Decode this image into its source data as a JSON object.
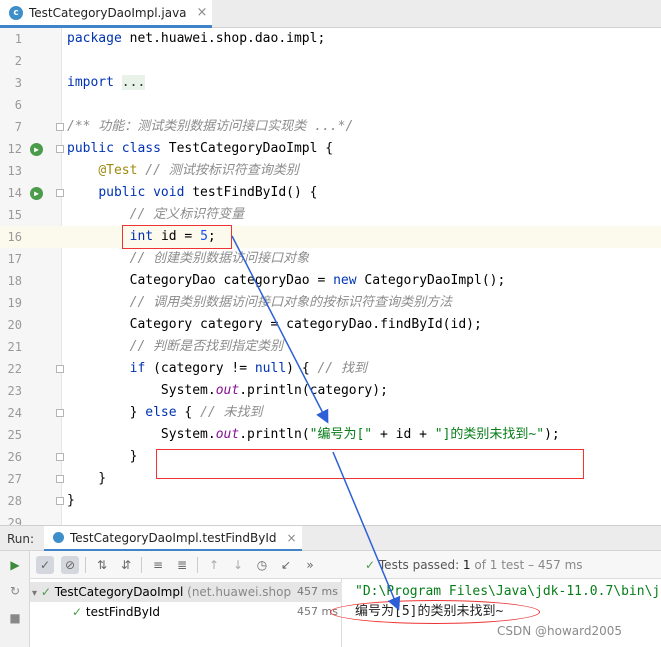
{
  "editor_tab": {
    "icon": "class-icon",
    "label": "TestCategoryDaoImpl.java",
    "close": "×"
  },
  "code_lines": [
    {
      "num": "1",
      "parts": [
        [
          "kw",
          "package "
        ],
        [
          "",
          "net.huawei.shop.dao.impl;"
        ]
      ]
    },
    {
      "num": "2",
      "parts": []
    },
    {
      "num": "3",
      "parts": [
        [
          "kw",
          "import "
        ],
        [
          "fold",
          "..."
        ]
      ]
    },
    {
      "num": "6",
      "parts": []
    },
    {
      "num": "7",
      "parts": [
        [
          "cm",
          "/** 功能：测试类别数据访问接口实现类 ...*/"
        ]
      ]
    },
    {
      "num": "12",
      "parts": [
        [
          "kw",
          "public class "
        ],
        [
          "",
          "TestCategoryDaoImpl {"
        ]
      ]
    },
    {
      "num": "13",
      "parts": [
        [
          "",
          "    "
        ],
        [
          "an",
          "@Test"
        ],
        [
          "cm",
          " // 测试按标识符查询类别"
        ]
      ]
    },
    {
      "num": "14",
      "parts": [
        [
          "",
          "    "
        ],
        [
          "kw",
          "public void "
        ],
        [
          "",
          "testFindById() {"
        ]
      ]
    },
    {
      "num": "15",
      "parts": [
        [
          "cm",
          "        // 定义标识符变量"
        ]
      ]
    },
    {
      "num": "16",
      "parts": [
        [
          "",
          "        "
        ],
        [
          "kw",
          "int "
        ],
        [
          "",
          "id = "
        ],
        [
          "nu",
          "5"
        ],
        [
          "",
          ";"
        ]
      ]
    },
    {
      "num": "17",
      "parts": [
        [
          "cm",
          "        // 创建类别数据访问接口对象"
        ]
      ]
    },
    {
      "num": "18",
      "parts": [
        [
          "",
          "        CategoryDao categoryDao = "
        ],
        [
          "kw",
          "new "
        ],
        [
          "",
          "CategoryDaoImpl();"
        ]
      ]
    },
    {
      "num": "19",
      "parts": [
        [
          "cm",
          "        // 调用类别数据访问接口对象的按标识符查询类别方法"
        ]
      ]
    },
    {
      "num": "20",
      "parts": [
        [
          "",
          "        Category category = categoryDao.findById(id);"
        ]
      ]
    },
    {
      "num": "21",
      "parts": [
        [
          "cm",
          "        // 判断是否找到指定类别"
        ]
      ]
    },
    {
      "num": "22",
      "parts": [
        [
          "",
          "        "
        ],
        [
          "kw",
          "if "
        ],
        [
          "",
          "(category != "
        ],
        [
          "kw",
          "null"
        ],
        [
          "",
          ") { "
        ],
        [
          "cm",
          "// 找到"
        ]
      ]
    },
    {
      "num": "23",
      "parts": [
        [
          "",
          "            System."
        ],
        [
          "fi",
          "out"
        ],
        [
          "",
          ".println(category);"
        ]
      ]
    },
    {
      "num": "24",
      "parts": [
        [
          "",
          "        } "
        ],
        [
          "kw",
          "else "
        ],
        [
          "",
          "{ "
        ],
        [
          "cm",
          "// 未找到"
        ]
      ]
    },
    {
      "num": "25",
      "parts": [
        [
          "",
          "            System."
        ],
        [
          "fi",
          "out"
        ],
        [
          "",
          ".println("
        ],
        [
          "st",
          "\"编号为[\""
        ],
        [
          "",
          " + id + "
        ],
        [
          "st",
          "\"]的类别未找到~\""
        ],
        [
          "",
          ");"
        ]
      ]
    },
    {
      "num": "26",
      "parts": [
        [
          "",
          "        }"
        ]
      ]
    },
    {
      "num": "27",
      "parts": [
        [
          "",
          "    }"
        ]
      ]
    },
    {
      "num": "28",
      "parts": [
        [
          "",
          "}"
        ]
      ]
    },
    {
      "num": "29",
      "parts": []
    }
  ],
  "run_panel": {
    "label": "Run:",
    "tab_label": "TestCategoryDaoImpl.testFindById",
    "tab_close": "×",
    "status_prefix": "Tests passed: ",
    "status_count": "1",
    "status_suffix": " of 1 test – 457 ms",
    "tree": [
      {
        "label": "TestCategoryDaoImpl",
        "package": "(net.huawei.shop",
        "duration": "457 ms"
      },
      {
        "label": "testFindById",
        "package": "",
        "duration": "457 ms"
      }
    ],
    "console": [
      "\"D:\\Program Files\\Java\\jdk-11.0.7\\bin\\j",
      "编号为[5]的类别未找到~"
    ]
  },
  "watermark": "CSDN @howard2005",
  "colors": {
    "accent": "#4083c9",
    "annotation_red": "#e33333",
    "arrow_blue": "#2d5fd6"
  }
}
